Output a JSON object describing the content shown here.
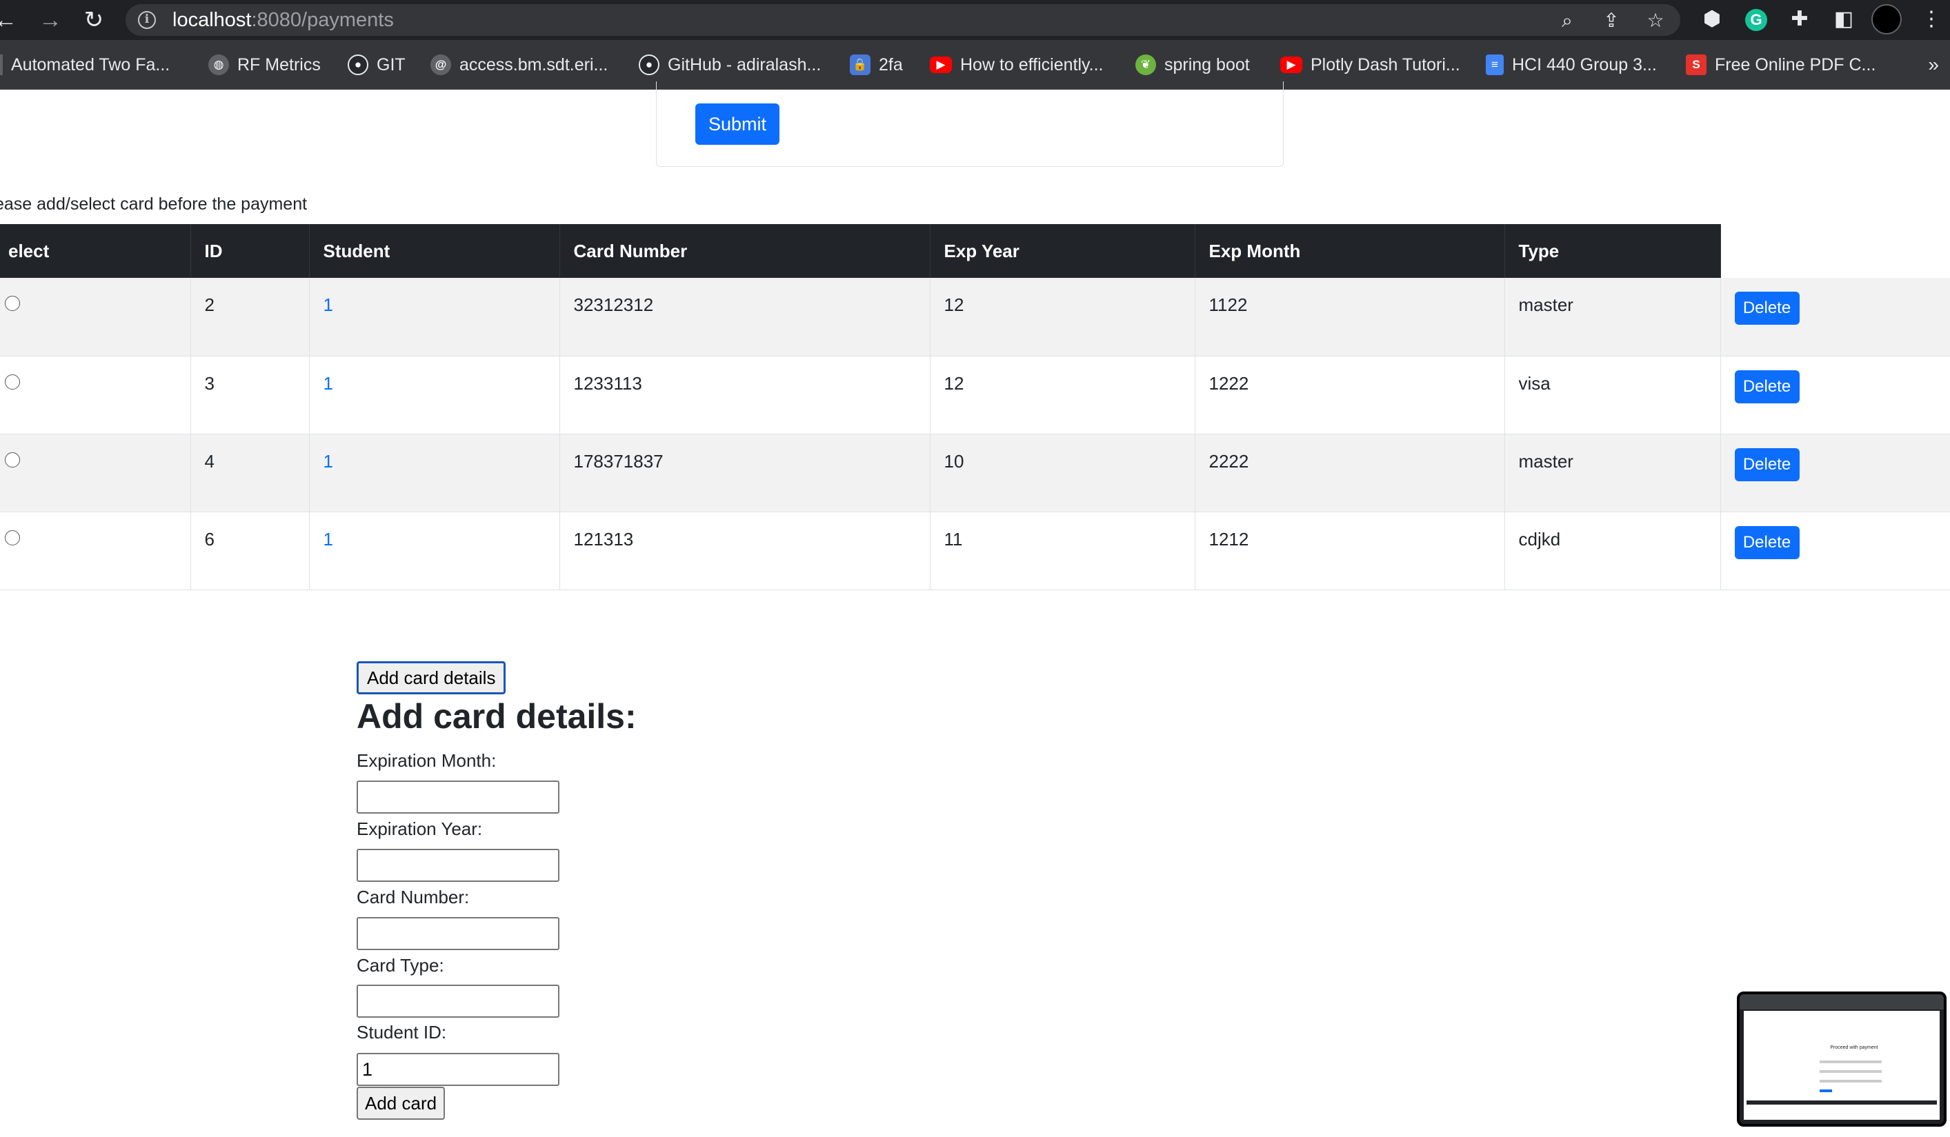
{
  "browser": {
    "url_host": "localhost",
    "url_path": ":8080/payments",
    "icons": [
      "back-icon",
      "forward-icon",
      "reload-icon",
      "info-icon",
      "zoom-icon",
      "share-icon",
      "star-icon",
      "extension-icon",
      "grammarly-icon",
      "puzzle-icon",
      "sidepanel-icon",
      "avatar",
      "menu-icon"
    ]
  },
  "bookmarks": [
    {
      "label": "Automated Two Fa...",
      "color": "#5f6368"
    },
    {
      "label": "RF Metrics",
      "color": "#5f6368"
    },
    {
      "label": "GIT",
      "color": "#24292e"
    },
    {
      "label": "access.bm.sdt.eri...",
      "color": "#5f6368"
    },
    {
      "label": "GitHub - adiralash...",
      "color": "#24292e"
    },
    {
      "label": "2fa",
      "color": "#4a78d6"
    },
    {
      "label": "How to efficiently...",
      "color": "#ff0000"
    },
    {
      "label": "spring boot",
      "color": "#6db33f"
    },
    {
      "label": "Plotly Dash Tutori...",
      "color": "#ff0000"
    },
    {
      "label": "HCI 440 Group 3...",
      "color": "#4285f4"
    },
    {
      "label": "Free Online PDF C...",
      "color": "#e5322d"
    }
  ],
  "payment_form": {
    "submit_label": "Submit"
  },
  "notice": "ease add/select card before the payment",
  "cards_table": {
    "headers": [
      "elect",
      "ID",
      "Student",
      "Card Number",
      "Exp Year",
      "Exp Month",
      "Type"
    ],
    "rows": [
      {
        "id": "2",
        "student": "1",
        "card_number": "32312312",
        "exp_year": "12",
        "exp_month": "1122",
        "type": "master",
        "action": "Delete"
      },
      {
        "id": "3",
        "student": "1",
        "card_number": "1233113",
        "exp_year": "12",
        "exp_month": "1222",
        "type": "visa",
        "action": "Delete"
      },
      {
        "id": "4",
        "student": "1",
        "card_number": "178371837",
        "exp_year": "10",
        "exp_month": "2222",
        "type": "master",
        "action": "Delete"
      },
      {
        "id": "6",
        "student": "1",
        "card_number": "121313",
        "exp_year": "11",
        "exp_month": "1212",
        "type": "cdjkd",
        "action": "Delete"
      }
    ]
  },
  "add_card": {
    "toggle_label": "Add card details",
    "heading": "Add card details:",
    "fields": [
      {
        "label": "Expiration Month:",
        "value": ""
      },
      {
        "label": "Expiration Year:",
        "value": ""
      },
      {
        "label": "Card Number:",
        "value": ""
      },
      {
        "label": "Card Type:",
        "value": ""
      },
      {
        "label": "Student ID:",
        "value": "1"
      }
    ],
    "submit_label": "Add card"
  },
  "preview_thumbnail": {
    "title": "Proceed with payment"
  }
}
